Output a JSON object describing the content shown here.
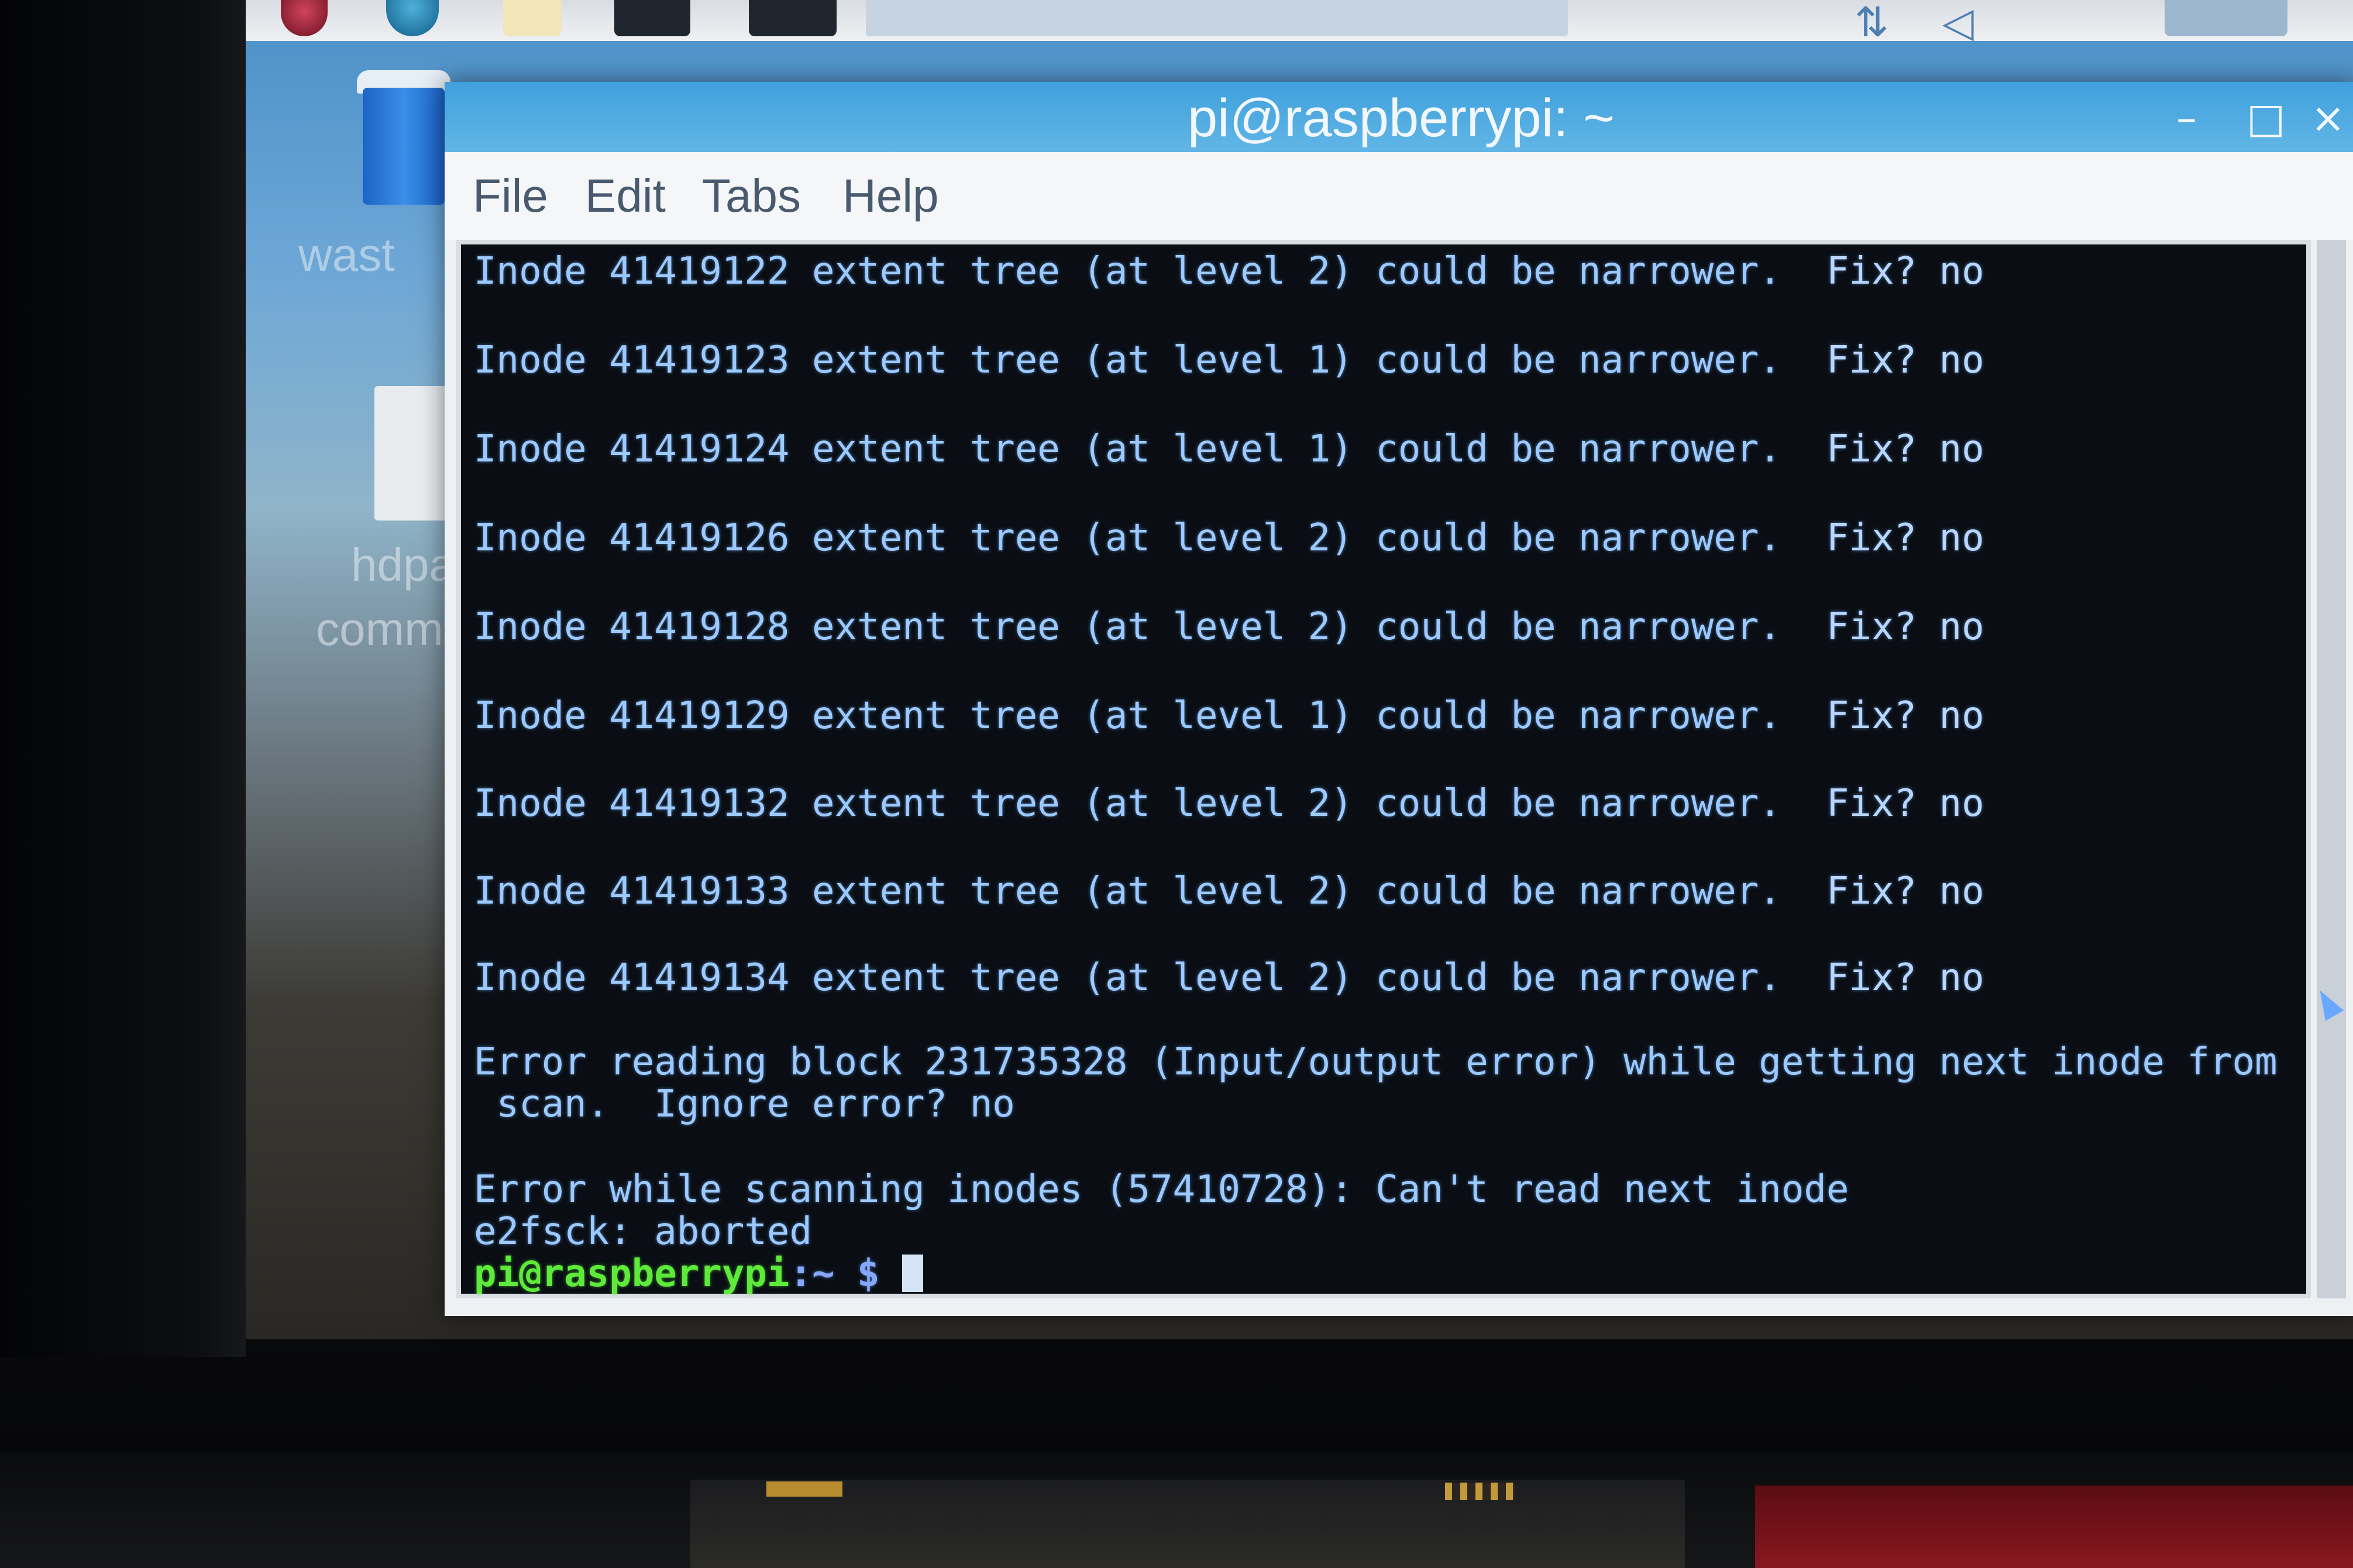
{
  "window": {
    "title": "pi@raspberrypi: ~",
    "minimize_glyph": "–",
    "maximize_glyph": "□",
    "close_glyph": "×"
  },
  "menu": {
    "items": [
      "File",
      "Edit",
      "Tabs",
      "Help"
    ]
  },
  "desktop": {
    "labels": [
      "wast",
      "hdpa",
      "comm"
    ]
  },
  "terminal": {
    "inode_lines": [
      {
        "text": "Inode 41419122 extent tree (at level 2) could be narrower.",
        "fix": "Fix? no"
      },
      {
        "text": "Inode 41419123 extent tree (at level 1) could be narrower.",
        "fix": "Fix? no"
      },
      {
        "text": "Inode 41419124 extent tree (at level 1) could be narrower.",
        "fix": "Fix? no"
      },
      {
        "text": "Inode 41419126 extent tree (at level 2) could be narrower.",
        "fix": "Fix? no"
      },
      {
        "text": "Inode 41419128 extent tree (at level 2) could be narrower.",
        "fix": "Fix? no"
      },
      {
        "text": "Inode 41419129 extent tree (at level 1) could be narrower.",
        "fix": "Fix? no"
      },
      {
        "text": "Inode 41419132 extent tree (at level 2) could be narrower.",
        "fix": "Fix? no"
      },
      {
        "text": "Inode 41419133 extent tree (at level 2) could be narrower.",
        "fix": "Fix? no"
      },
      {
        "text": "Inode 41419134 extent tree (at level 2) could be narrower.",
        "fix": "Fix? no"
      }
    ],
    "error1_line1": "Error reading block 231735328 (Input/output error) while getting next inode from",
    "error1_line2": " scan.  Ignore error? no",
    "error2": "Error while scanning inodes (57410728): Can't read next inode",
    "aborted": "e2fsck: aborted",
    "prompt_user": "pi@raspberrypi",
    "prompt_path": ":~ $ "
  }
}
